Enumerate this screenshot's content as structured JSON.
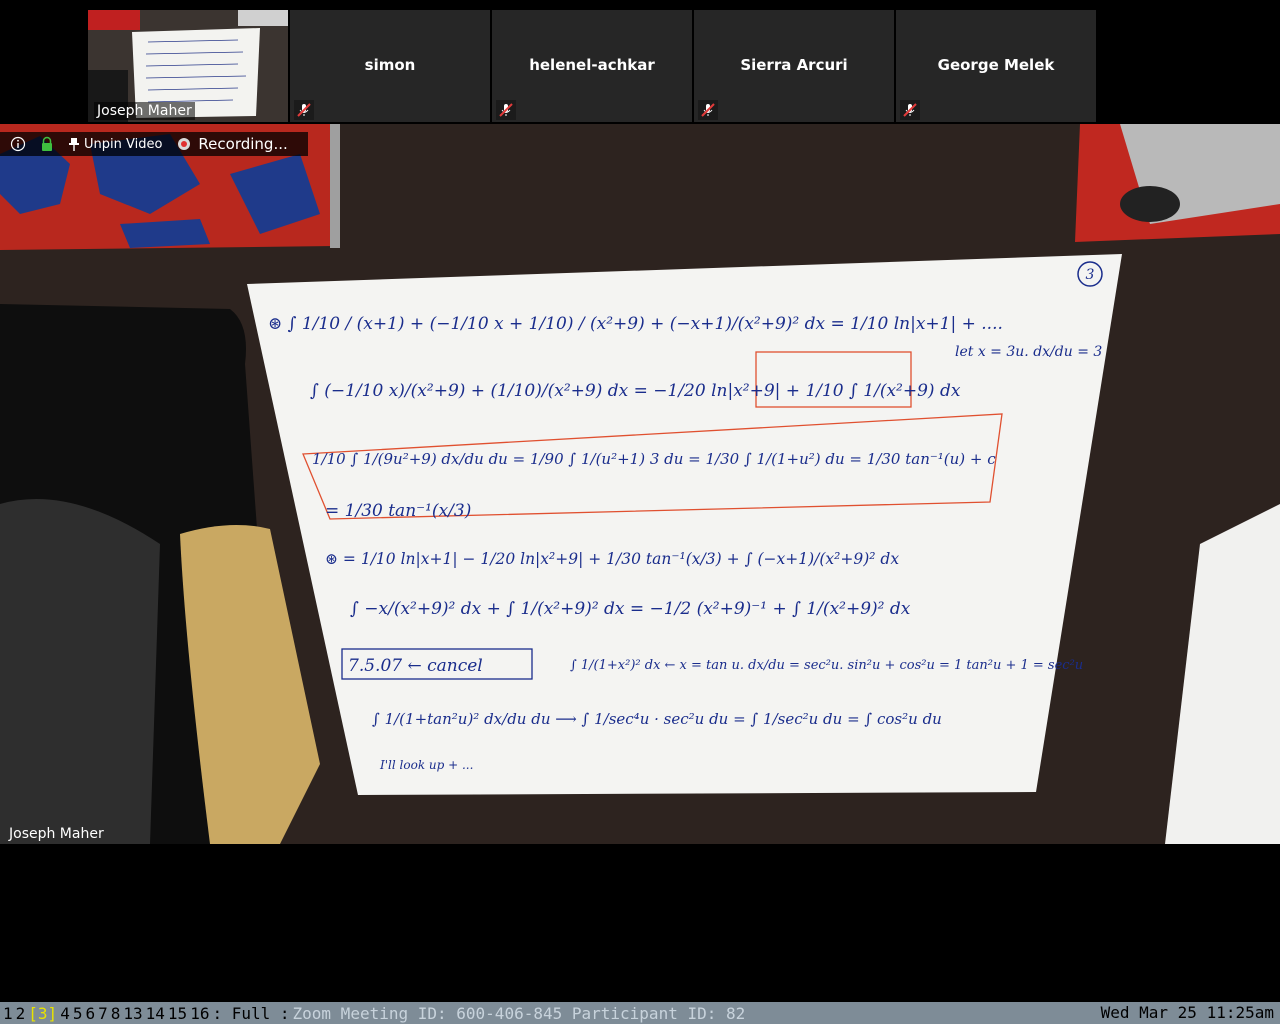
{
  "participants": [
    {
      "name": "Joseph Maher",
      "muted": false,
      "has_video": true
    },
    {
      "name": "simon",
      "muted": true,
      "has_video": false
    },
    {
      "name": "helenel-achkar",
      "muted": true,
      "has_video": false
    },
    {
      "name": "Sierra Arcuri",
      "muted": true,
      "has_video": false
    },
    {
      "name": "George Melek",
      "muted": true,
      "has_video": false
    }
  ],
  "toolbar": {
    "info_icon": "info-icon",
    "lock_icon": "lock-icon",
    "unpin_label": "Unpin Video",
    "recording_label": "Recording..."
  },
  "main_video": {
    "speaker_name": "Joseph Maher"
  },
  "whiteboard": {
    "page_number": "3",
    "ink_color": "#1a2d8c",
    "box_color": "#e05030",
    "lines": [
      "⊛ ∫ 1/10 / (x+1)  +  (−1/10 x + 1/10) / (x²+9)  +  (−x+1)/(x²+9)²  dx  =  1/10 ln|x+1|  + ....",
      "∫ (−1/10 x)/(x²+9) + (1/10)/(x²+9) dx = −1/20 ln|x²+9| + 1/10 ∫ 1/(x²+9) dx",
      "let x = 3u.   dx/du = 3",
      "1/10 ∫ 1/(9u²+9) dx/du du = 1/90 ∫ 1/(u²+1) 3 du = 1/30 ∫ 1/(1+u²) du = 1/30 tan⁻¹(u) + c",
      "= 1/30 tan⁻¹(x/3)",
      "⊛ = 1/10 ln|x+1| − 1/20 ln|x²+9| + 1/30 tan⁻¹(x/3) + ∫ (−x+1)/(x²+9)² dx",
      "∫ −x/(x²+9)² dx + ∫ 1/(x²+9)² dx  =  −1/2 (x²+9)⁻¹ + ∫ 1/(x²+9)² dx",
      "7.5.07 ← cancel",
      "∫ 1/(1+x²)² dx  ←  x = tan u.   dx/du = sec²u.     sin²u + cos²u = 1    tan²u + 1 = sec²u",
      "∫ 1/(1+tan²u)² dx/du du  ⟶  ∫ 1/sec⁴u · sec²u du  =  ∫ 1/sec²u du  =  ∫ cos²u du",
      "I'll look up + ..."
    ]
  },
  "statusbar": {
    "workspaces": [
      "1",
      "2",
      "[3]",
      "4",
      "5",
      "6",
      "7",
      "8",
      "13",
      "14",
      "15",
      "16"
    ],
    "active_workspace": "[3]",
    "mode": ": Full :",
    "info": "Zoom Meeting ID: 600-406-845 Participant ID: 82",
    "clock": "Wed Mar 25 11:25am"
  }
}
